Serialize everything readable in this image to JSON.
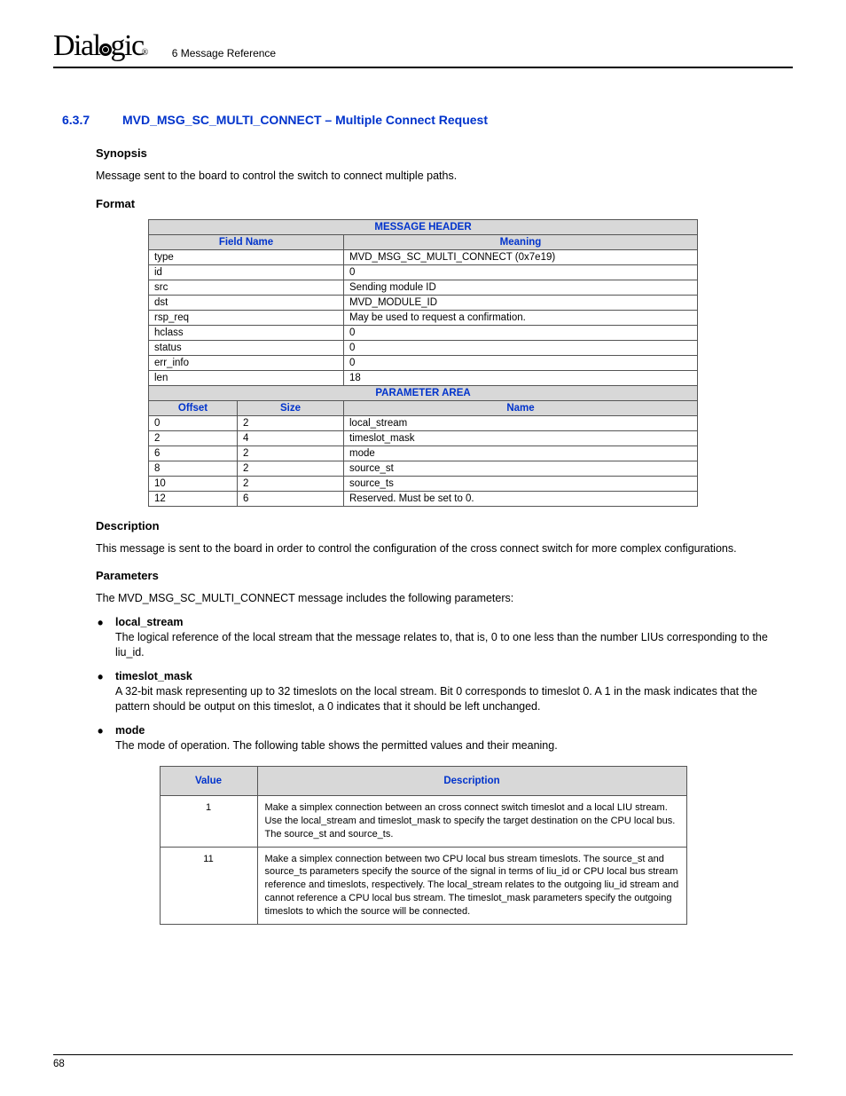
{
  "chapter": "6 Message Reference",
  "section": {
    "number": "6.3.7",
    "title": "MVD_MSG_SC_MULTI_CONNECT – Multiple Connect Request"
  },
  "synopsis": {
    "head": "Synopsis",
    "text": "Message sent to the board to control the switch to connect multiple paths."
  },
  "format": {
    "head": "Format",
    "msgHeader": "MESSAGE HEADER",
    "fieldNameHead": "Field Name",
    "meaningHead": "Meaning",
    "rows": [
      {
        "f": "type",
        "m": "MVD_MSG_SC_MULTI_CONNECT (0x7e19)"
      },
      {
        "f": "id",
        "m": "0"
      },
      {
        "f": "src",
        "m": "Sending module ID"
      },
      {
        "f": "dst",
        "m": "MVD_MODULE_ID"
      },
      {
        "f": "rsp_req",
        "m": "May be used to request a confirmation."
      },
      {
        "f": "hclass",
        "m": "0"
      },
      {
        "f": "status",
        "m": "0"
      },
      {
        "f": "err_info",
        "m": "0"
      },
      {
        "f": "len",
        "m": "18"
      }
    ],
    "paramArea": "PARAMETER AREA",
    "offsetHead": "Offset",
    "sizeHead": "Size",
    "nameHead": "Name",
    "params": [
      {
        "o": "0",
        "s": "2",
        "n": "local_stream"
      },
      {
        "o": "2",
        "s": "4",
        "n": "timeslot_mask"
      },
      {
        "o": "6",
        "s": "2",
        "n": "mode"
      },
      {
        "o": "8",
        "s": "2",
        "n": "source_st"
      },
      {
        "o": "10",
        "s": "2",
        "n": "source_ts"
      },
      {
        "o": "12",
        "s": "6",
        "n": "Reserved. Must be set to 0."
      }
    ]
  },
  "description": {
    "head": "Description",
    "text": "This message is sent to the board in order to control the configuration of the cross connect switch for more complex configurations."
  },
  "parameters": {
    "head": "Parameters",
    "intro": "The MVD_MSG_SC_MULTI_CONNECT message includes the following parameters:",
    "items": [
      {
        "name": "local_stream",
        "desc": "The logical reference of the local stream that the message relates to, that is, 0 to one less than the number LIUs corresponding to the liu_id."
      },
      {
        "name": "timeslot_mask",
        "desc": "A 32-bit mask representing up to 32 timeslots on the local stream. Bit 0 corresponds to timeslot 0. A 1 in the mask indicates that the pattern should be output on this timeslot, a 0 indicates that it should be left unchanged."
      },
      {
        "name": "mode",
        "desc": "The mode of operation. The following table shows the permitted values and their meaning."
      }
    ]
  },
  "modeTable": {
    "valueHead": "Value",
    "descHead": "Description",
    "rows": [
      {
        "v": "1",
        "d": "Make a simplex connection between an cross connect switch timeslot and a local LIU stream. Use the local_stream and timeslot_mask to specify the target destination on the CPU local bus. The source_st and source_ts."
      },
      {
        "v": "11",
        "d": "Make a simplex connection between two CPU local bus stream timeslots. The source_st and source_ts parameters specify the source of the signal in terms of liu_id or CPU local bus stream reference and timeslots, respectively. The local_stream relates to the outgoing liu_id stream and cannot reference a CPU local bus stream. The timeslot_mask parameters specify the outgoing timeslots to which the source will be connected."
      }
    ]
  },
  "pageNumber": "68"
}
